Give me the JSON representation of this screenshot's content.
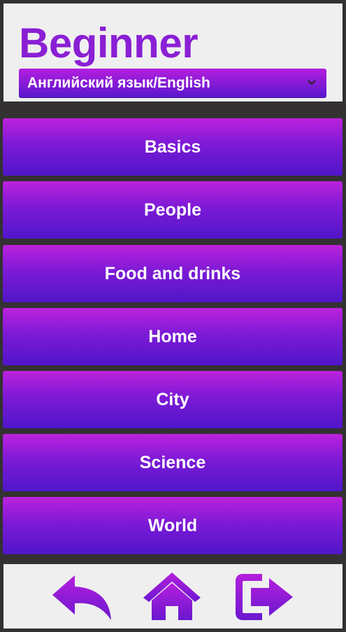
{
  "header": {
    "title": "Beginner",
    "language_select": {
      "selected": "Английский язык/English",
      "icon": "chevron-down-icon"
    }
  },
  "menu": {
    "items": [
      {
        "label": "Basics"
      },
      {
        "label": "People"
      },
      {
        "label": "Food and drinks"
      },
      {
        "label": "Home"
      },
      {
        "label": "City"
      },
      {
        "label": "Science"
      },
      {
        "label": "World"
      }
    ]
  },
  "bottom_nav": {
    "icons": [
      "back-arrow-icon",
      "home-icon",
      "exit-icon"
    ]
  },
  "colors": {
    "accent": "#8a1fd4",
    "gradient_top": "#bc22dc",
    "gradient_bottom": "#5016c9",
    "panel_bg": "#efefef",
    "page_bg": "#333131"
  }
}
